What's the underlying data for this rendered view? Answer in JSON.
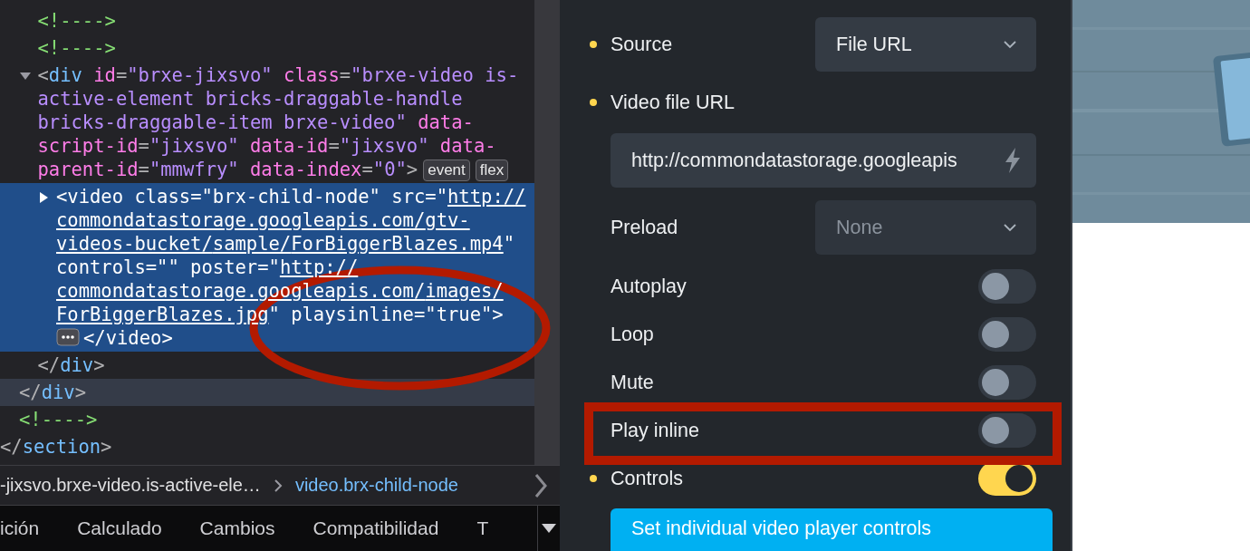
{
  "devtools": {
    "tree": {
      "kind": "element",
      "close": "</section>",
      "children": [
        {
          "kind": "element",
          "close": "</div>",
          "close_hovered": true,
          "children": [
            {
              "kind": "comment",
              "text": "<!---->"
            },
            {
              "kind": "comment",
              "text": "<!---->"
            },
            {
              "kind": "element",
              "expanded": true,
              "selected": false,
              "open": [
                {
                  "kind": "punct",
                  "text": "<"
                },
                {
                  "kind": "tag",
                  "text": "div"
                },
                {
                  "kind": "attr",
                  "text": " id"
                },
                {
                  "kind": "punct",
                  "text": "="
                },
                {
                  "kind": "value",
                  "text": "\"brxe-jixsvo\""
                },
                {
                  "kind": "attr",
                  "text": " class"
                },
                {
                  "kind": "punct",
                  "text": "="
                },
                {
                  "kind": "value",
                  "text": "\"brxe-video is-active-element bricks-draggable-handle bricks-draggable-item brxe-video\""
                },
                {
                  "kind": "attr",
                  "text": " data-script-id"
                },
                {
                  "kind": "punct",
                  "text": "="
                },
                {
                  "kind": "value",
                  "text": "\"jixsvo\""
                },
                {
                  "kind": "attr",
                  "text": " data-id"
                },
                {
                  "kind": "punct",
                  "text": "="
                },
                {
                  "kind": "value",
                  "text": "\"jixsvo\""
                },
                {
                  "kind": "attr",
                  "text": " data-parent-id"
                },
                {
                  "kind": "punct",
                  "text": "="
                },
                {
                  "kind": "value",
                  "text": "\"mmwfry\""
                },
                {
                  "kind": "attr",
                  "text": " data-index"
                },
                {
                  "kind": "punct",
                  "text": "="
                },
                {
                  "kind": "value",
                  "text": "\"0\""
                },
                {
                  "kind": "punct",
                  "text": ">"
                }
              ],
              "badges": [
                "event",
                "flex"
              ],
              "close": "</div>",
              "children": [
                {
                  "kind": "element",
                  "expanded": false,
                  "selected": true,
                  "open": [
                    {
                      "kind": "punct",
                      "text": "<"
                    },
                    {
                      "kind": "tag",
                      "text": "video"
                    },
                    {
                      "kind": "attr",
                      "text": " class"
                    },
                    {
                      "kind": "punct",
                      "text": "="
                    },
                    {
                      "kind": "value",
                      "text": "\"brx-child-node\""
                    },
                    {
                      "kind": "attr",
                      "text": " src"
                    },
                    {
                      "kind": "punct",
                      "text": "="
                    },
                    {
                      "kind": "value",
                      "text": "\""
                    },
                    {
                      "kind": "link",
                      "text": "http://commondatastorage.googleapis.com/gtv-videos-bucket/sample/ForBiggerBlazes.mp4"
                    },
                    {
                      "kind": "value",
                      "text": "\""
                    },
                    {
                      "kind": "attr",
                      "text": " controls"
                    },
                    {
                      "kind": "punct",
                      "text": "="
                    },
                    {
                      "kind": "value",
                      "text": "\"\""
                    },
                    {
                      "kind": "attr",
                      "text": " poster"
                    },
                    {
                      "kind": "punct",
                      "text": "="
                    },
                    {
                      "kind": "value",
                      "text": "\""
                    },
                    {
                      "kind": "link",
                      "text": "http://commondatastorage.googleapis.com/images/ForBiggerBlazes.jpg"
                    },
                    {
                      "kind": "value",
                      "text": "\""
                    },
                    {
                      "kind": "attr",
                      "text": " playsinline"
                    },
                    {
                      "kind": "punct",
                      "text": "="
                    },
                    {
                      "kind": "value",
                      "text": "\"true\""
                    },
                    {
                      "kind": "punct",
                      "text": ">"
                    }
                  ],
                  "close": "</video>"
                }
              ]
            }
          ]
        },
        {
          "kind": "comment",
          "text": "<!---->"
        }
      ]
    },
    "breadcrumb": [
      {
        "text": "-jixsvo.brxe-video.is-active-ele…",
        "selected": false
      },
      {
        "text": "video.brx-child-node",
        "selected": true
      }
    ],
    "tabs": [
      "ición",
      "Calculado",
      "Cambios",
      "Compatibilidad",
      "T"
    ]
  },
  "settings": {
    "fields": [
      {
        "kind": "select",
        "label": "Source",
        "modified": true,
        "value": "File URL"
      },
      {
        "kind": "heading",
        "label": "Video file URL",
        "modified": true
      },
      {
        "kind": "input",
        "value": "http://commondatastorage.googleapis"
      },
      {
        "kind": "select",
        "label": "Preload",
        "modified": false,
        "placeholder": "None"
      },
      {
        "kind": "toggle",
        "label": "Autoplay",
        "modified": false,
        "on": false
      },
      {
        "kind": "toggle",
        "label": "Loop",
        "modified": false,
        "on": false
      },
      {
        "kind": "toggle",
        "label": "Mute",
        "modified": false,
        "on": false
      },
      {
        "kind": "toggle",
        "label": "Play inline",
        "modified": false,
        "on": false
      },
      {
        "kind": "toggle",
        "label": "Controls",
        "modified": true,
        "on": true
      },
      {
        "kind": "button",
        "label": "Set individual video player controls"
      }
    ]
  },
  "annotations": [
    {
      "kind": "ellipse"
    },
    {
      "kind": "rectangle"
    }
  ]
}
